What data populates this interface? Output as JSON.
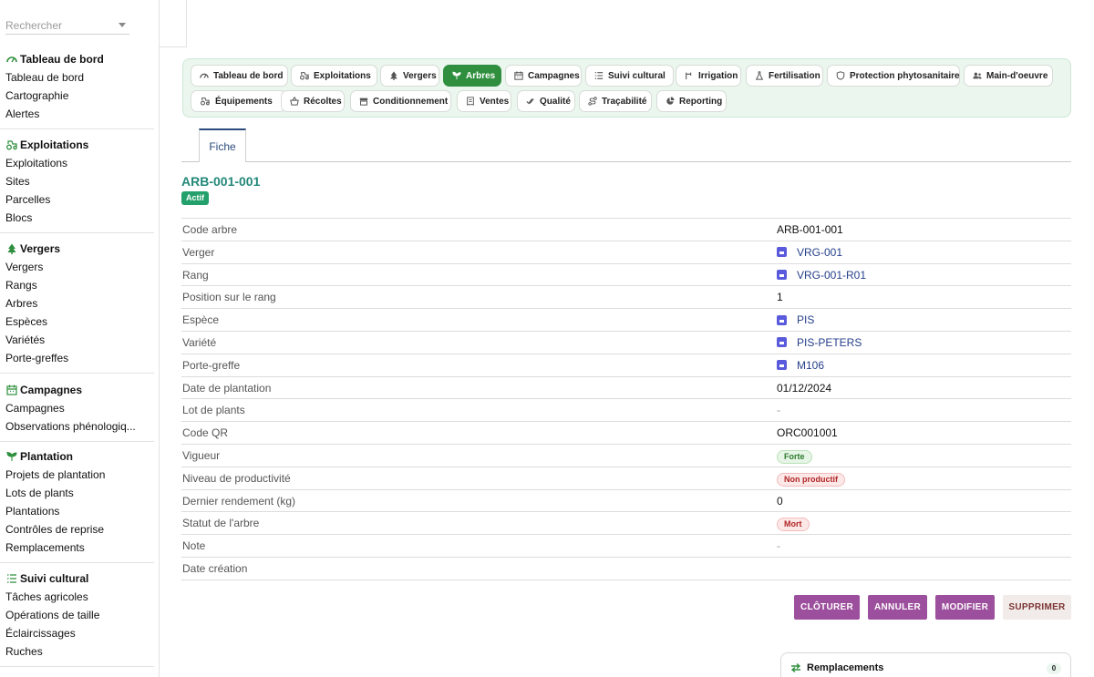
{
  "search": {
    "placeholder": "Rechercher"
  },
  "sidebar": {
    "sections": [
      {
        "title": "Tableau de bord",
        "icon": "gauge-icon",
        "items": [
          "Tableau de bord",
          "Cartographie",
          "Alertes"
        ]
      },
      {
        "title": "Exploitations",
        "icon": "tractor-icon",
        "items": [
          "Exploitations",
          "Sites",
          "Parcelles",
          "Blocs"
        ]
      },
      {
        "title": "Vergers",
        "icon": "tree-icon",
        "items": [
          "Vergers",
          "Rangs",
          "Arbres",
          "Espèces",
          "Variétés",
          "Porte-greffes"
        ]
      },
      {
        "title": "Campagnes",
        "icon": "calendar-icon",
        "items": [
          "Campagnes",
          "Observations phénologiq..."
        ]
      },
      {
        "title": "Plantation",
        "icon": "seedling-icon",
        "items": [
          "Projets de plantation",
          "Lots de plants",
          "Plantations",
          "Contrôles de reprise",
          "Remplacements"
        ]
      },
      {
        "title": "Suivi cultural",
        "icon": "list-icon",
        "items": [
          "Tâches agricoles",
          "Opérations de taille",
          "Éclaircissages",
          "Ruches"
        ]
      }
    ]
  },
  "modules": [
    {
      "label": "Tableau de bord",
      "icon": "gauge-icon"
    },
    {
      "label": "Exploitations",
      "icon": "tractor-icon"
    },
    {
      "label": "Vergers",
      "icon": "tree-icon"
    },
    {
      "label": "Arbres",
      "icon": "seedling-icon",
      "active": true
    },
    {
      "label": "Campagnes",
      "icon": "calendar-icon"
    },
    {
      "label": "Suivi cultural",
      "icon": "list-icon"
    },
    {
      "label": "Irrigation",
      "icon": "faucet-icon"
    },
    {
      "label": "Fertilisation",
      "icon": "flask-icon"
    },
    {
      "label": "Protection phytosanitaire",
      "icon": "shield-icon"
    },
    {
      "label": "Main-d'oeuvre",
      "icon": "users-icon"
    },
    {
      "label": "Équipements",
      "icon": "tractor-icon"
    },
    {
      "label": "Récoltes",
      "icon": "basket-icon"
    },
    {
      "label": "Conditionnement",
      "icon": "box-icon"
    },
    {
      "label": "Ventes",
      "icon": "receipt-icon"
    },
    {
      "label": "Qualité",
      "icon": "check-icon"
    },
    {
      "label": "Traçabilité",
      "icon": "route-icon"
    },
    {
      "label": "Reporting",
      "icon": "piechart-icon"
    }
  ],
  "tabs": {
    "fiche": "Fiche"
  },
  "record": {
    "title": "ARB-001-001",
    "status": "Actif",
    "fields": [
      {
        "label": "Code arbre",
        "value": "ARB-001-001",
        "type": "text"
      },
      {
        "label": "Verger",
        "value": "VRG-001",
        "type": "link"
      },
      {
        "label": "Rang",
        "value": "VRG-001-R01",
        "type": "link"
      },
      {
        "label": "Position sur le rang",
        "value": "1",
        "type": "text"
      },
      {
        "label": "Espèce",
        "value": "PIS",
        "type": "link"
      },
      {
        "label": "Variété",
        "value": "PIS-PETERS",
        "type": "link"
      },
      {
        "label": "Porte-greffe",
        "value": "M106",
        "type": "link"
      },
      {
        "label": "Date de plantation",
        "value": "01/12/2024",
        "type": "text"
      },
      {
        "label": "Lot de plants",
        "value": "-",
        "type": "dash"
      },
      {
        "label": "Code QR",
        "value": "ORC001001",
        "type": "text"
      },
      {
        "label": "Vigueur",
        "value": "Forte",
        "type": "chip-green"
      },
      {
        "label": "Niveau de productivité",
        "value": "Non productif",
        "type": "chip-red"
      },
      {
        "label": "Dernier rendement (kg)",
        "value": "0",
        "type": "text"
      },
      {
        "label": "Statut de l'arbre",
        "value": "Mort",
        "type": "chip-red"
      },
      {
        "label": "Note",
        "value": "-",
        "type": "dash"
      },
      {
        "label": "Date création",
        "value": "",
        "type": "text"
      }
    ]
  },
  "actions": {
    "cloturer": "CLÔTURER",
    "annuler": "ANNULER",
    "modifier": "MODIFIER",
    "supprimer": "SUPPRIMER"
  },
  "panel": {
    "title": "Remplacements",
    "count": "0"
  },
  "colors": {
    "accent": "#2f8f3e",
    "title": "#23887a",
    "link": "#26408b",
    "action": "#9c4f9c"
  }
}
